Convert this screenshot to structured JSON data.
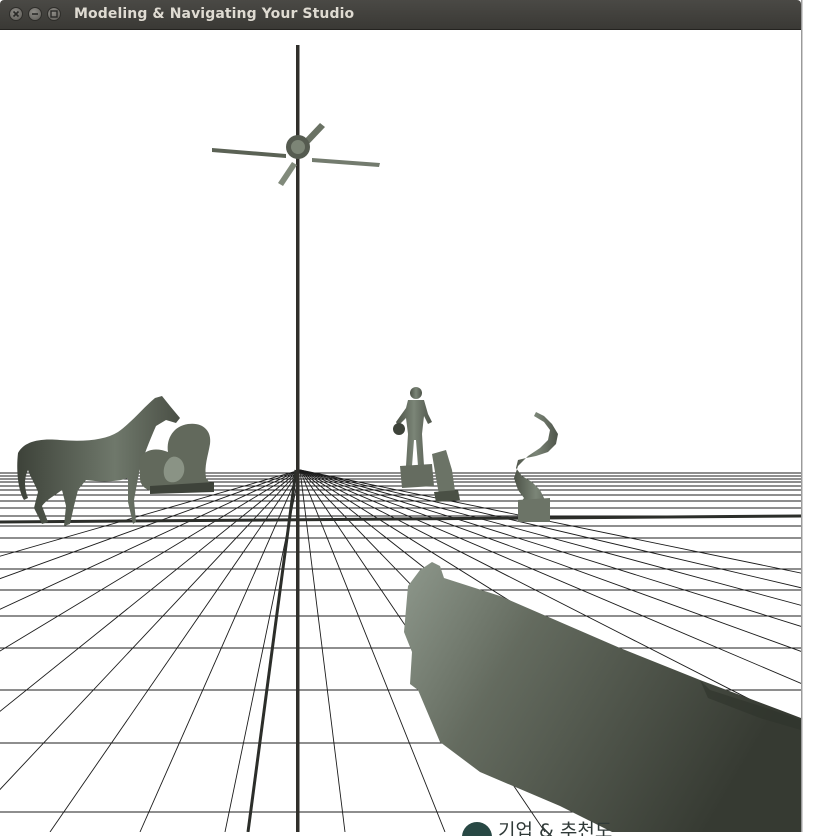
{
  "window": {
    "title": "Modeling & Navigating Your Studio",
    "controls": [
      "close-icon",
      "minimize-icon",
      "maximize-icon"
    ]
  },
  "scene": {
    "objects": [
      "horse",
      "lion-statue",
      "ceiling-fan",
      "basketball-player",
      "spiral-staircase",
      "pillar-statue",
      "handgun"
    ],
    "floor": "grid",
    "colors": {
      "background": "#ffffff",
      "grid_line": "#1c1c1c",
      "model_light": "#8c978a",
      "model_dark": "#3b3f36"
    }
  },
  "background_window": {
    "text": "기업 & 추천도"
  }
}
